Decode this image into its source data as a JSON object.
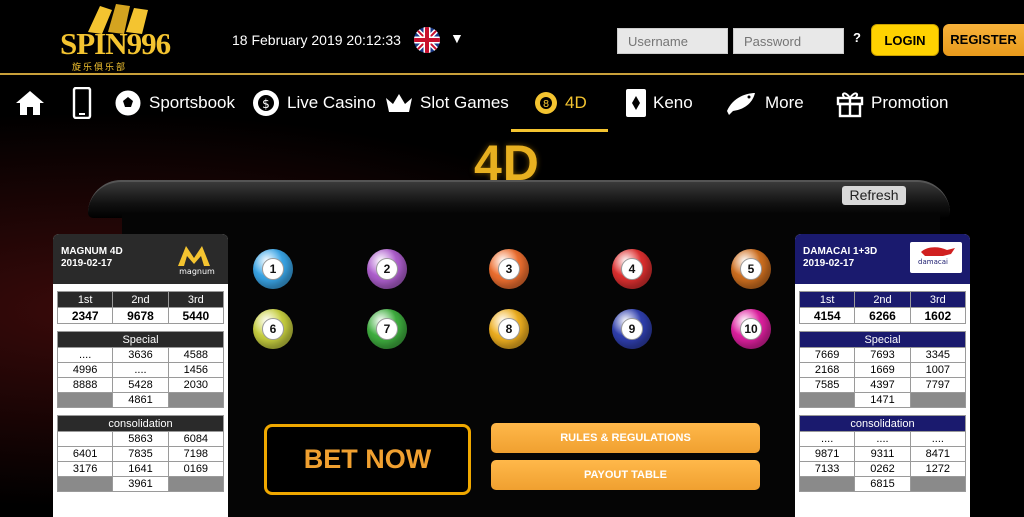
{
  "header": {
    "logo_text": "SPIN996",
    "logo_sub": "旋乐俱乐部",
    "datetime": "18 February 2019 20:12:33",
    "language_flag": "uk-flag-icon",
    "username_placeholder": "Username",
    "password_placeholder": "Password",
    "help_label": "?",
    "login_label": "LOGIN",
    "register_label": "REGISTER"
  },
  "nav": {
    "items": [
      {
        "icon": "home-icon",
        "label": ""
      },
      {
        "icon": "mobile-icon",
        "label": ""
      },
      {
        "icon": "soccer-ball-icon",
        "label": "Sportsbook"
      },
      {
        "icon": "casino-chip-icon",
        "label": "Live Casino"
      },
      {
        "icon": "crown-icon",
        "label": "Slot Games"
      },
      {
        "icon": "ball-8-icon",
        "label": "4D"
      },
      {
        "icon": "card-icon",
        "label": "Keno"
      },
      {
        "icon": "fish-icon",
        "label": "More"
      },
      {
        "icon": "gift-icon",
        "label": "Promotion"
      }
    ],
    "active": "4D"
  },
  "page_title": "4D",
  "refresh_label": "Refresh",
  "balls": [
    "1",
    "2",
    "3",
    "4",
    "5",
    "6",
    "7",
    "8",
    "9",
    "10"
  ],
  "ball_colors": [
    "#3aa6e8",
    "#b060d0",
    "#f07030",
    "#e03030",
    "#d07020",
    "#c8d040",
    "#40b040",
    "#f0b020",
    "#3040b0",
    "#e020a0"
  ],
  "bet_now_label": "BET NOW",
  "rules_label": "RULES & REGULATIONS",
  "payout_label": "PAYOUT TABLE",
  "magnum": {
    "name": "MAGNUM 4D",
    "date": "2019-02-17",
    "logo_text": "magnum",
    "header_color": "#2a2a2a",
    "prize_headers": [
      "1st",
      "2nd",
      "3rd"
    ],
    "prizes": [
      "2347",
      "9678",
      "5440"
    ],
    "special_label": "Special",
    "special": [
      [
        "....",
        "3636",
        "4588"
      ],
      [
        "4996",
        "....",
        "1456"
      ],
      [
        "8888",
        "5428",
        "2030"
      ],
      [
        "",
        "4861",
        ""
      ]
    ],
    "consolation_label": "consolidation",
    "consolation": [
      [
        "",
        "5863",
        "6084"
      ],
      [
        "6401",
        "7835",
        "7198"
      ],
      [
        "3176",
        "1641",
        "0169"
      ],
      [
        "",
        "3961",
        ""
      ]
    ]
  },
  "damacai": {
    "name": "DAMACAI 1+3D",
    "date": "2019-02-17",
    "logo_text": "damacai",
    "header_color": "#1a1a6e",
    "prize_headers": [
      "1st",
      "2nd",
      "3rd"
    ],
    "prizes": [
      "4154",
      "6266",
      "1602"
    ],
    "special_label": "Special",
    "special": [
      [
        "7669",
        "7693",
        "3345"
      ],
      [
        "2168",
        "1669",
        "1007"
      ],
      [
        "7585",
        "4397",
        "7797"
      ],
      [
        "",
        "1471",
        ""
      ]
    ],
    "consolation_label": "consolidation",
    "consolation": [
      [
        "....",
        "....",
        "...."
      ],
      [
        "9871",
        "9311",
        "8471"
      ],
      [
        "7133",
        "0262",
        "1272"
      ],
      [
        "",
        "6815",
        ""
      ]
    ]
  }
}
